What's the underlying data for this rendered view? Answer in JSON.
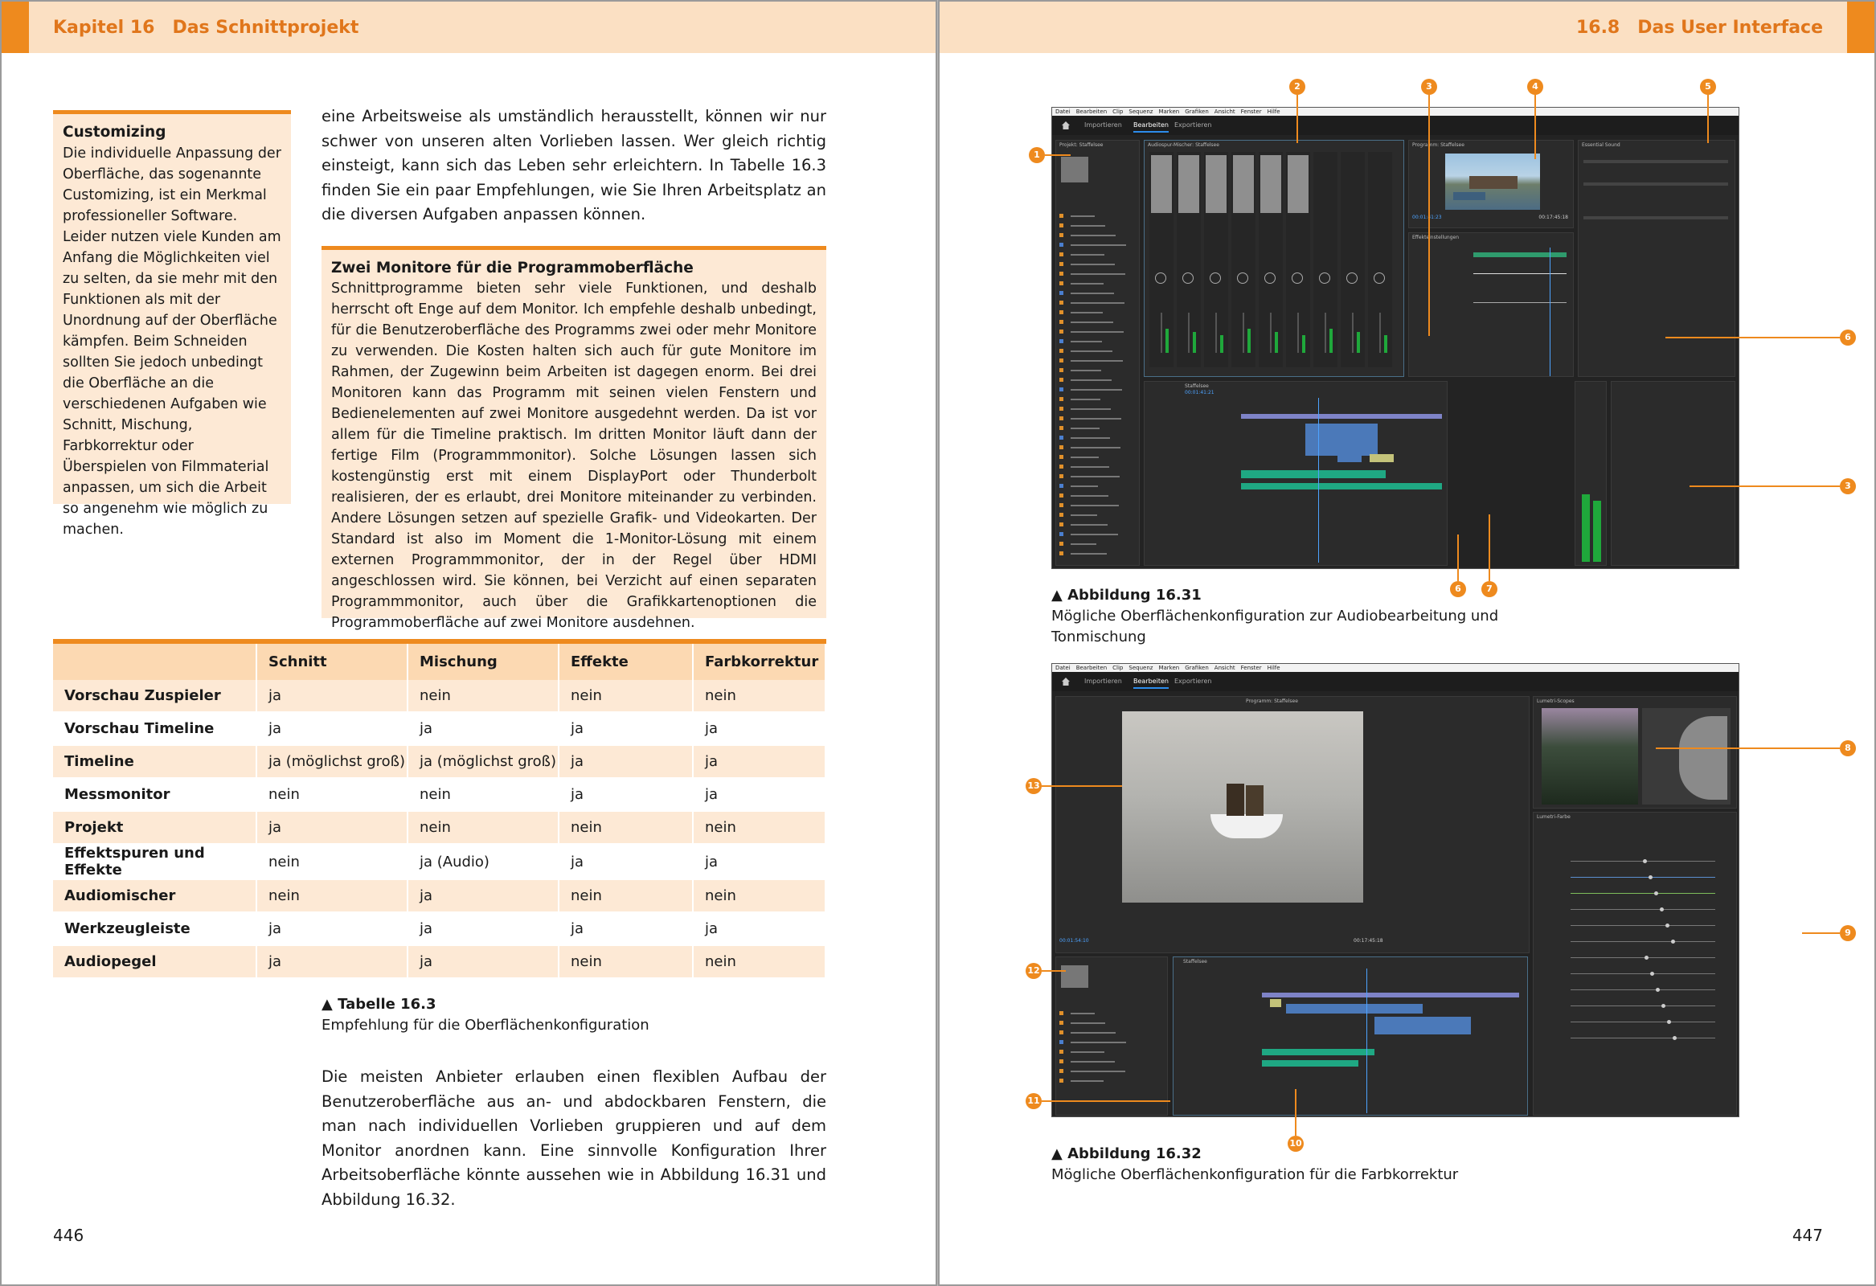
{
  "left_page": {
    "header_num": "Kapitel 16",
    "header_title": "Das Schnittprojekt",
    "page_number": "446",
    "margin_box": {
      "title": "Customizing",
      "text": "Die individuelle Anpassung der Oberfläche, das sogenannte Customizing, ist ein Merkmal professioneller Software. Leider nutzen viele Kunden am Anfang die Möglichkeiten viel zu selten, da sie mehr mit den Funktionen als mit der Unordnung auf der Oberfläche kämpfen. Beim Schneiden sollten Sie jedoch unbedingt die Oberfläche an die verschiedenen Aufgaben wie Schnitt, Mischung, Farbkorrektur oder Überspielen von Filmmaterial anpassen, um sich die Arbeit so angenehm wie möglich zu machen."
    },
    "intro_text": "eine Arbeitsweise als umständlich herausstellt, können wir nur schwer von unseren alten Vorlieben lassen. Wer gleich richtig einsteigt, kann sich das Leben sehr erleichtern. In Tabelle 16.3 finden Sie ein paar Empfehlungen, wie Sie Ihren Arbeitsplatz an die diversen Aufgaben anpassen können.",
    "info_box": {
      "title": "Zwei Monitore für die Programmoberfläche",
      "text": "Schnittprogramme bieten sehr viele Funktionen, und deshalb herrscht oft Enge auf dem Monitor. Ich empfehle deshalb unbedingt, für die Benutzeroberfläche des Programms zwei oder mehr Monitore zu verwenden. Die Kosten halten sich auch für gute Monitore im Rahmen, der Zugewinn beim Arbeiten ist dagegen enorm. Bei drei Monitoren kann das Programm mit seinen vielen Fenstern und Bedienelementen auf zwei Monitore ausgedehnt werden. Da ist vor allem für die Timeline praktisch. Im dritten Monitor läuft dann der fertige Film (Programmmonitor). Solche Lösungen lassen sich kostengünstig erst mit einem DisplayPort oder Thunderbolt realisieren, der es erlaubt, drei Monitore miteinander zu verbinden. Andere Lösungen setzen auf spezielle Grafik- und Videokarten. Der Standard ist also im Moment die 1-Monitor-Lösung mit einem externen Programmmonitor, der in der Regel über HDMI angeschlossen wird. Sie können, bei Verzicht auf einen separaten Programmmonitor, auch über die Grafikkartenoptionen die Programmoberfläche auf zwei Monitore ausdehnen."
    },
    "table": {
      "headers": [
        "",
        "Schnitt",
        "Mischung",
        "Effekte",
        "Farbkorrektur"
      ],
      "rows": [
        [
          "Vorschau Zuspieler",
          "ja",
          "nein",
          "nein",
          "nein"
        ],
        [
          "Vorschau Timeline",
          "ja",
          "ja",
          "ja",
          "ja"
        ],
        [
          "Timeline",
          "ja (möglichst groß)",
          "ja (möglichst groß)",
          "ja",
          "ja"
        ],
        [
          "Messmonitor",
          "nein",
          "nein",
          "ja",
          "ja"
        ],
        [
          "Projekt",
          "ja",
          "nein",
          "nein",
          "nein"
        ],
        [
          "Effektspuren und Effekte",
          "nein",
          "ja (Audio)",
          "ja",
          "ja"
        ],
        [
          "Audiomischer",
          "nein",
          "ja",
          "nein",
          "nein"
        ],
        [
          "Werkzeugleiste",
          "ja",
          "ja",
          "ja",
          "ja"
        ],
        [
          "Audiopegel",
          "ja",
          "ja",
          "nein",
          "nein"
        ]
      ]
    },
    "table_caption": {
      "title": "▲ Tabelle 16.3",
      "text": "Empfehlung für die Oberflächenkonfiguration"
    },
    "closing_text": "Die meisten Anbieter erlauben einen flexiblen Aufbau der Benutzeroberfläche aus an- und abdockbaren Fenstern, die man nach individuellen Vorlieben gruppieren und auf dem Monitor anordnen kann. Eine sinnvolle Konfiguration Ihrer Arbeitsoberfläche könnte aussehen wie in Abbildung 16.31 und Abbildung 16.32."
  },
  "right_page": {
    "header_num": "16.8",
    "header_title": "Das User Interface",
    "page_number": "447",
    "figure1": {
      "caption_title": "▲ Abbildung 16.31",
      "caption_text": "Mögliche Oberflächenkonfiguration zur Audiobearbeitung und Tonmischung",
      "menu": [
        "Datei",
        "Bearbeiten",
        "Clip",
        "Sequenz",
        "Marken",
        "Grafiken",
        "Ansicht",
        "Fenster",
        "Hilfe"
      ],
      "tabs": [
        "Importieren",
        "Bearbeiten",
        "Exportieren"
      ],
      "panel_labels": [
        "Projekt: Staffelsee",
        "Audioclip-Mischer: Staffelsee",
        "Audiospur-Mischer: Staffelsee",
        "Programm: Staffelsee",
        "Essential Sound",
        "Effekteinstellungen",
        "Staffelsee"
      ],
      "timecodes": [
        "00:01:41:23",
        "00:17:45:18",
        "00:01:41:21"
      ],
      "callouts": [
        "1",
        "2",
        "3",
        "4",
        "5",
        "6",
        "3",
        "6",
        "7"
      ]
    },
    "figure2": {
      "caption_title": "▲ Abbildung 16.32",
      "caption_text": "Mögliche Oberflächenkonfiguration für die Farbkorrektur",
      "menu": [
        "Datei",
        "Bearbeiten",
        "Clip",
        "Sequenz",
        "Marken",
        "Grafiken",
        "Ansicht",
        "Fenster",
        "Hilfe"
      ],
      "tabs": [
        "Importieren",
        "Bearbeiten",
        "Exportieren"
      ],
      "panel_labels": [
        "Lumetri-Scopes",
        "Lumetri-Farbe",
        "Staffelsee",
        "Programm: Staffelsee"
      ],
      "timecodes": [
        "00:01:54:10",
        "00:17:45:18"
      ],
      "callouts": [
        "8",
        "9",
        "10",
        "11",
        "12",
        "13"
      ]
    }
  },
  "colors": {
    "accent": "#ee8a1e",
    "header_bg": "#fbe0c3",
    "box_bg": "#fde9d5",
    "ui_dark": "#232323"
  }
}
